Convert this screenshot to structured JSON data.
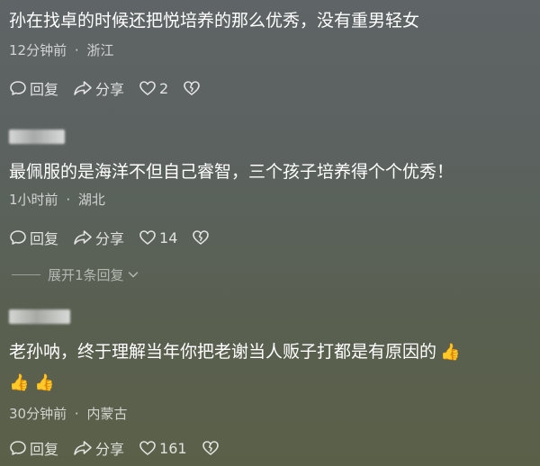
{
  "comments": [
    {
      "text": "孙在找卓的时候还把悦培养的那么优秀，没有重男轻女",
      "time": "12分钟前",
      "location": "浙江",
      "reply_label": "回复",
      "share_label": "分享",
      "likes": "2"
    },
    {
      "text": "最佩服的是海洋不但自己睿智，三个孩子培养得个个优秀！",
      "time": "1小时前",
      "location": "湖北",
      "reply_label": "回复",
      "share_label": "分享",
      "likes": "14"
    },
    {
      "text": "老孙呐，终于理解当年你把老谢当人贩子打都是有原因的",
      "time": "30分钟前",
      "location": "内蒙古",
      "reply_label": "回复",
      "share_label": "分享",
      "likes": "161",
      "emoji": "👍"
    }
  ],
  "expand_replies": "展开1条回复",
  "meta_separator": "·",
  "icons": {
    "reply": "speech-bubble-icon",
    "share": "share-arrow-icon",
    "like": "heart-icon",
    "dislike": "broken-heart-icon",
    "thumbs": "thumbs-up-emoji",
    "expand": "chevron-down-icon"
  },
  "colors": {
    "text": "#ffffff",
    "meta": "#c8cbc8",
    "emoji": "#f5b324"
  }
}
